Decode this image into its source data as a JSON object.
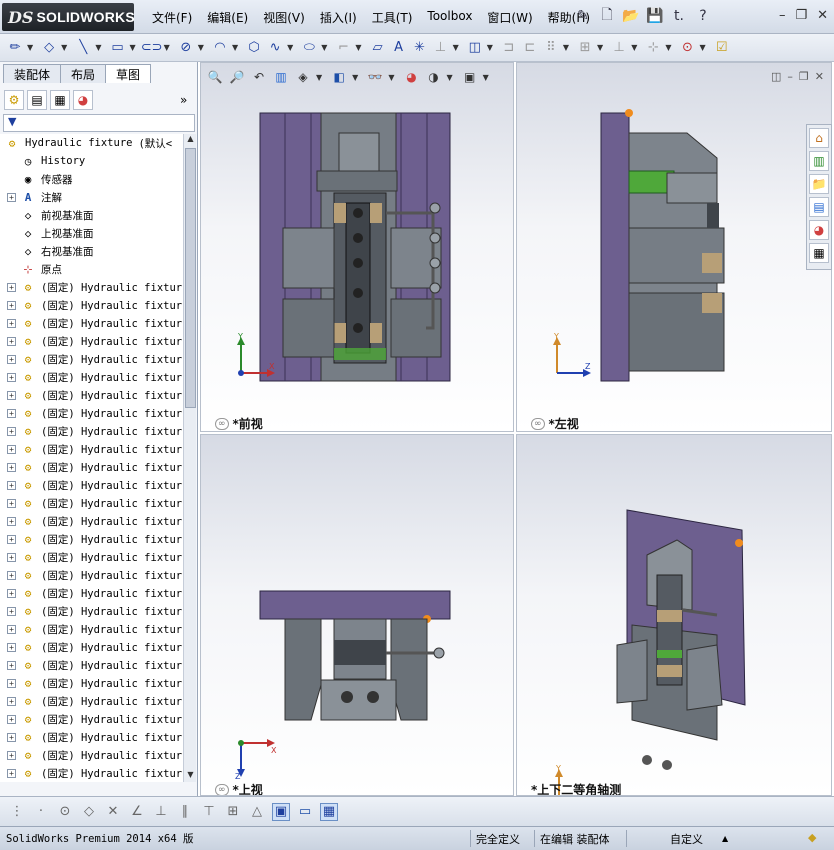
{
  "app": {
    "logo_prefix": "3DS",
    "logo_text": "SOLIDWORKS"
  },
  "menu": [
    "文件(F)",
    "编辑(E)",
    "视图(V)",
    "插入(I)",
    "工具(T)",
    "Toolbox",
    "窗口(W)",
    "帮助(H)"
  ],
  "title_icons": [
    "pin-icon",
    "new-document-icon",
    "open-icon",
    "save-icon",
    "print-icon",
    "help-icon"
  ],
  "window_controls": {
    "minimize": "–",
    "restore": "❐",
    "close": "✕"
  },
  "left_panel": {
    "tabs": [
      "装配体",
      "布局",
      "草图"
    ],
    "active_tab": "草图",
    "root": {
      "label": "Hydraulic fixture",
      "config": "(默认<"
    },
    "items": [
      {
        "label": "History",
        "expand": false,
        "icon": "history-icon"
      },
      {
        "label": "传感器",
        "expand": false,
        "icon": "sensor-icon"
      },
      {
        "label": "注解",
        "expand": true,
        "icon": "annotation-icon"
      },
      {
        "label": "前视基准面",
        "expand": false,
        "icon": "plane-icon"
      },
      {
        "label": "上视基准面",
        "expand": false,
        "icon": "plane-icon"
      },
      {
        "label": "右视基准面",
        "expand": false,
        "icon": "plane-icon"
      },
      {
        "label": "原点",
        "expand": false,
        "icon": "origin-icon"
      }
    ],
    "component_label": "(固定) Hydraulic fixtur",
    "component_count": 28
  },
  "viewports": {
    "front": "*前视",
    "left": "*左视",
    "top": "*上视",
    "iso": "*上下二等角轴测"
  },
  "axes": {
    "x": "X",
    "y": "Y",
    "z": "Z"
  },
  "status": {
    "version": "SolidWorks Premium 2014 x64 版",
    "definition": "完全定义",
    "editing": "在编辑 装配体",
    "custom": "自定义",
    "custom_arrow": "▲"
  },
  "colors": {
    "plate": "#6d5f8f",
    "steel": "#7d848c",
    "dark_steel": "#555b62",
    "accent_green": "#4fa83a",
    "tan": "#b79f77",
    "orange": "#f08c1e"
  }
}
